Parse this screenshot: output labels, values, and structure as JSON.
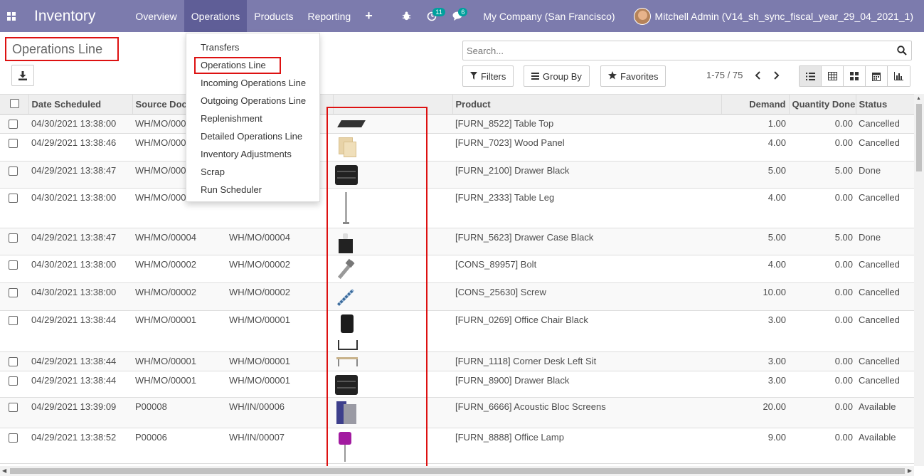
{
  "navbar": {
    "app_title": "Inventory",
    "menu": [
      "Overview",
      "Operations",
      "Products",
      "Reporting"
    ],
    "plus_label": "+",
    "activity_badge": "11",
    "messages_badge": "6",
    "company": "My Company (San Francisco)",
    "user": "Mitchell Admin (V14_sh_sync_fiscal_year_29_04_2021_1)",
    "accent_color": "#7c7bad"
  },
  "control_panel": {
    "breadcrumb": "Operations Line",
    "search_placeholder": "Search...",
    "filters_label": "Filters",
    "group_by_label": "Group By",
    "favorites_label": "Favorites",
    "pager": "1-75 / 75",
    "views": [
      "list-icon",
      "pivot-icon",
      "kanban-icon",
      "calendar-icon",
      "graph-icon"
    ]
  },
  "dropdown": {
    "items": [
      "Transfers",
      "Operations Line",
      "Incoming Operations Line",
      "Outgoing Operations Line",
      "Replenishment",
      "Detailed Operations Line",
      "Inventory Adjustments",
      "Scrap",
      "Run Scheduler"
    ]
  },
  "table": {
    "headers": [
      "Date Scheduled",
      "Source Doc",
      "",
      "",
      "Product",
      "Demand",
      "Quantity Done",
      "Status"
    ],
    "rows": [
      {
        "date": "04/30/2021 13:38:00",
        "source": "WH/MO/000",
        "ref": "",
        "img": "tabletop",
        "product": "[FURN_8522] Table Top",
        "demand": "1.00",
        "done": "0.00",
        "status": "Cancelled"
      },
      {
        "date": "04/29/2021 13:38:46",
        "source": "WH/MO/000",
        "ref": "",
        "img": "woodpanel",
        "product": "[FURN_7023] Wood Panel",
        "demand": "4.00",
        "done": "0.00",
        "status": "Cancelled"
      },
      {
        "date": "04/29/2021 13:38:47",
        "source": "WH/MO/000",
        "ref": "",
        "img": "drawer",
        "product": "[FURN_2100] Drawer Black",
        "demand": "5.00",
        "done": "5.00",
        "status": "Done"
      },
      {
        "date": "04/30/2021 13:38:00",
        "source": "WH/MO/000",
        "ref": "",
        "img": "tableleg",
        "product": "[FURN_2333] Table Leg",
        "demand": "4.00",
        "done": "0.00",
        "status": "Cancelled"
      },
      {
        "date": "04/29/2021 13:38:47",
        "source": "WH/MO/00004",
        "ref": "WH/MO/00004",
        "img": "drawercase",
        "product": "[FURN_5623] Drawer Case Black",
        "demand": "5.00",
        "done": "5.00",
        "status": "Done"
      },
      {
        "date": "04/30/2021 13:38:00",
        "source": "WH/MO/00002",
        "ref": "WH/MO/00002",
        "img": "bolt",
        "product": "[CONS_89957] Bolt",
        "demand": "4.00",
        "done": "0.00",
        "status": "Cancelled"
      },
      {
        "date": "04/30/2021 13:38:00",
        "source": "WH/MO/00002",
        "ref": "WH/MO/00002",
        "img": "screw",
        "product": "[CONS_25630] Screw",
        "demand": "10.00",
        "done": "0.00",
        "status": "Cancelled"
      },
      {
        "date": "04/29/2021 13:38:44",
        "source": "WH/MO/00001",
        "ref": "WH/MO/00001",
        "img": "chair",
        "product": "[FURN_0269] Office Chair Black",
        "demand": "3.00",
        "done": "0.00",
        "status": "Cancelled"
      },
      {
        "date": "04/29/2021 13:38:44",
        "source": "WH/MO/00001",
        "ref": "WH/MO/00001",
        "img": "corner",
        "product": "[FURN_1118] Corner Desk Left Sit",
        "demand": "3.00",
        "done": "0.00",
        "status": "Cancelled"
      },
      {
        "date": "04/29/2021 13:38:44",
        "source": "WH/MO/00001",
        "ref": "WH/MO/00001",
        "img": "drawer",
        "product": "[FURN_8900] Drawer Black",
        "demand": "3.00",
        "done": "0.00",
        "status": "Cancelled"
      },
      {
        "date": "04/29/2021 13:39:09",
        "source": "P00008",
        "ref": "WH/IN/00006",
        "img": "acoustic",
        "product": "[FURN_6666] Acoustic Bloc Screens",
        "demand": "20.00",
        "done": "0.00",
        "status": "Available"
      },
      {
        "date": "04/29/2021 13:38:52",
        "source": "P00006",
        "ref": "WH/IN/00007",
        "img": "lamp",
        "product": "[FURN_8888] Office Lamp",
        "demand": "9.00",
        "done": "0.00",
        "status": "Available"
      }
    ]
  }
}
